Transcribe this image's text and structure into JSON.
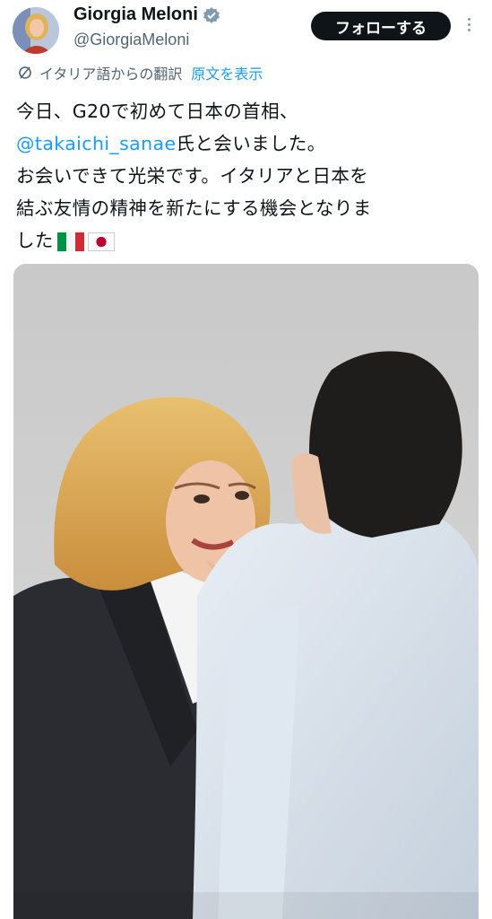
{
  "author": {
    "display_name": "Giorgia Meloni",
    "handle": "@GiorgiaMeloni",
    "avatar_icon": "profile-avatar",
    "verified_icon": "verified-badge-icon"
  },
  "follow_button": {
    "label": "フォローする"
  },
  "more_menu_icon": "more-options-icon",
  "translation": {
    "icon": "globe-icon",
    "translated_from": "イタリア語からの翻訳",
    "show_original": "原文を表示"
  },
  "tweet": {
    "line1": "今日、G20で初めて日本の首相、",
    "mention": "@takaichi_sanae",
    "line2_suffix": "氏と会いました。",
    "line3": "お会いできて光栄です。イタリアと日本を",
    "line4": "結ぶ友情の精神を新たにする機会となりま",
    "line5": "した",
    "flags": [
      "italy-flag",
      "japan-flag"
    ]
  },
  "media": {
    "photo_icon": "tweet-photo"
  },
  "colors": {
    "accent": "#1d9bf0",
    "text": "#0f1419",
    "secondary": "#536471",
    "follow_bg": "#0f1419"
  }
}
